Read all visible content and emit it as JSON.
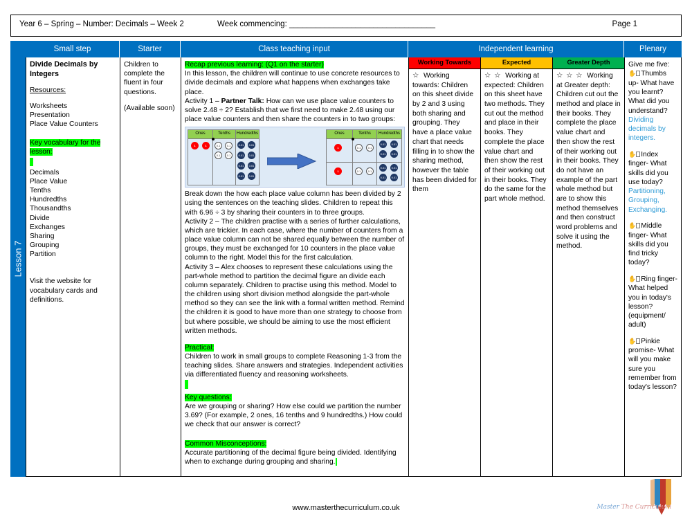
{
  "header": {
    "title": "Year 6 – Spring – Number: Decimals – Week 2",
    "week_commencing": "Week commencing: _________________________________",
    "page": "Page 1"
  },
  "lesson_tab": {
    "label": "Lesson 7"
  },
  "columns": {
    "small_step": "Small step",
    "starter": "Starter",
    "class_teaching_input": "Class teaching input",
    "independent_learning": "Independent learning",
    "plenary": "Plenary"
  },
  "small_step": {
    "title": "Divide Decimals by Integers",
    "resources_label": "Resources:",
    "resources": [
      "Worksheets",
      "Presentation",
      "Place Value Counters"
    ],
    "key_vocab_heading": "Key vocabulary for the lesson:",
    "vocab": [
      "Decimals",
      "Place Value",
      "Tenths",
      "Hundredths",
      "Thousandths",
      "Divide",
      "Exchanges",
      "Sharing",
      "Grouping",
      "Partition"
    ],
    "footer_note": "Visit the website for vocabulary cards and definitions."
  },
  "starter": {
    "line1": "Children to complete the fluent in four questions.",
    "line2": "(Available soon)"
  },
  "class_input": {
    "recap_heading": "Recap previous learning: (Q1 on the starter)",
    "intro": "In this lesson, the children will continue to use concrete resources to divide decimals and explore what happens when exchanges take place.",
    "activity1_label": "Activity 1 – ",
    "activity1_bold": "Partner Talk:",
    "activity1_text": " How can we use place value counters to solve 2.48 ÷ 2? Establish that we first need to make 2.48 using our place value counters and then share the counters in to two groups:",
    "after_figure": "Break down the how each place value column has been divided by 2 using the sentences on the teaching slides. Children to repeat this with 6.96 ÷ 3 by sharing their counters in to three groups.",
    "activity2": "Activity 2 – The children practise with a series of further calculations, which are trickier.  In each case, where the number of counters from a place value column can not  be shared equally between the number of groups, they must be exchanged for 10 counters in the place value column to the right. Model this for the first calculation.",
    "activity3": "Activity 3 – Alex chooses to represent these calculations using the part-whole method to partition the decimal figure an divide each column separately. Children to practise using this method. Model to the children using short division method alongside the part-whole method so they can see the link with a formal written method. Remind the children it is good to have more than one strategy to choose from but where possible, we should be aiming to use the most efficient written methods.",
    "practical_heading": "Practical:",
    "practical_text": "Children to work in small groups to complete Reasoning 1-3 from the teaching slides. Share answers and strategies. Independent activities via differentiated fluency and reasoning worksheets.",
    "key_questions_heading": "Key questions:",
    "key_questions_text": "Are we grouping or sharing? How else could we partition the number 3.69?  (For example, 2 ones, 16 tenths and 9 hundredths.) How could we check that our answer is correct?",
    "misconceptions_heading": "Common Misconceptions:",
    "misconceptions_text": "Accurate partitioning of the decimal figure being divided. Identifying when to exchange during grouping and sharing."
  },
  "figure": {
    "headers": [
      "Ones",
      "Tenths",
      "Hundredths"
    ],
    "counter_labels": {
      "one": "1",
      "tenth": "0.1",
      "hundredth": "0.01"
    },
    "left_chart": {
      "ones": 2,
      "tenths": 4,
      "hundredths": 8,
      "represents": "2.48"
    },
    "right_chart": {
      "groups": 2,
      "per_group": {
        "ones": 1,
        "tenths": 2,
        "hundredths": 4
      },
      "represents": "1.24"
    },
    "arrow": "right-arrow"
  },
  "independent": {
    "working_towards": {
      "heading": "Working Towards",
      "color": "#FF0000",
      "stars": "☆",
      "label": "Working towards:",
      "text": "Children on this sheet divide by 2 and 3 using both sharing and grouping. They have a place value chart that needs filling in to show the sharing method, however the table has been divided for them"
    },
    "expected": {
      "heading": "Expected",
      "color": "#FFC000",
      "stars": "☆ ☆",
      "label": "Working at expected:",
      "text": "Children on this sheet have two methods. They cut out the method and place in their books. They complete the place value chart and then show the rest of their working out in their books. They do the same for the part whole method."
    },
    "greater_depth": {
      "heading": "Greater Depth",
      "color": "#00B050",
      "stars": "☆ ☆ ☆",
      "label": "Working at Greater depth:",
      "text": "Children cut out the method and place in their books. They complete the place value chart and then show the rest of their working out in their books. They do not have an example of the part whole method but are to show this method themselves and then construct word problems and solve it using the method."
    }
  },
  "plenary": {
    "intro": "Give me five:",
    "items": [
      {
        "prompt": "Thumbs up- What have you learnt? What did you understand?",
        "answer": "Dividing decimals by integers."
      },
      {
        "prompt": "Index finger- What skills did you use today?",
        "answer": "Partitioning, Grouping, Exchanging."
      },
      {
        "prompt": "Middle finger- What skills did you find tricky today?",
        "answer": ""
      },
      {
        "prompt": "Ring finger- What helped you in today's lesson? (equipment/ adult)",
        "answer": ""
      },
      {
        "prompt": "Pinkie promise- What will you make sure you remember from today's lesson?",
        "answer": ""
      }
    ]
  },
  "footer": {
    "url": "www.masterthecurriculum.co.uk",
    "logo_words": [
      "Master",
      "The",
      "Curriculum"
    ]
  }
}
